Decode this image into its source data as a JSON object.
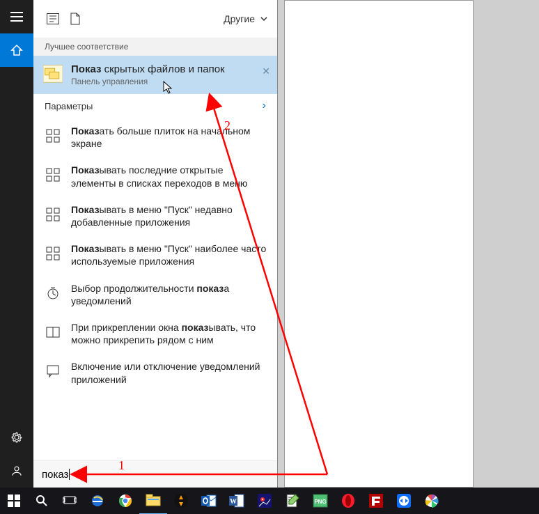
{
  "left_rail": {
    "menu": "≡",
    "home": "⌂",
    "settings": "⚙",
    "user": "👤"
  },
  "search_top": {
    "filter_label": "Другие"
  },
  "sections": {
    "best_match": "Лучшее соответствие",
    "params": "Параметры"
  },
  "best_match_item": {
    "prefix": "Показ",
    "rest": " скрытых файлов и папок",
    "sub": "Панель управления"
  },
  "settings_items": [
    {
      "prefix": "Показ",
      "rest": "ать больше плиток на начальном экране",
      "icon": "tiles"
    },
    {
      "prefix": "Показ",
      "rest": "ывать последние открытые элементы в списках переходов в меню",
      "icon": "tiles"
    },
    {
      "prefix": "Показ",
      "rest": "ывать в меню \"Пуск\" недавно добавленные приложения",
      "icon": "tiles"
    },
    {
      "prefix": "Показ",
      "rest": "ывать в меню \"Пуск\" наиболее часто используемые приложения",
      "icon": "tiles"
    },
    {
      "text_before": "Выбор продолжительности ",
      "bold": "показ",
      "text_after": "а уведомлений",
      "icon": "timer"
    },
    {
      "text_before": "При прикреплении окна ",
      "bold": "показ",
      "text_after": "ывать, что можно прикрепить рядом с ним",
      "icon": "snap"
    },
    {
      "plain": "Включение или отключение уведомлений приложений",
      "icon": "notif"
    }
  ],
  "search_input": {
    "value": "показ"
  },
  "annotations": {
    "num1": "1",
    "num2": "2"
  },
  "colors": {
    "accent": "#0078d7",
    "highlight": "#bfdcf3",
    "arrow": "#ff0000"
  },
  "taskbar_icons": [
    "start",
    "search",
    "taskview",
    "ie",
    "chrome",
    "explorer",
    "aimp",
    "outlook",
    "word",
    "irfan",
    "npp",
    "png",
    "opera",
    "filezilla",
    "tv",
    "picasa"
  ]
}
